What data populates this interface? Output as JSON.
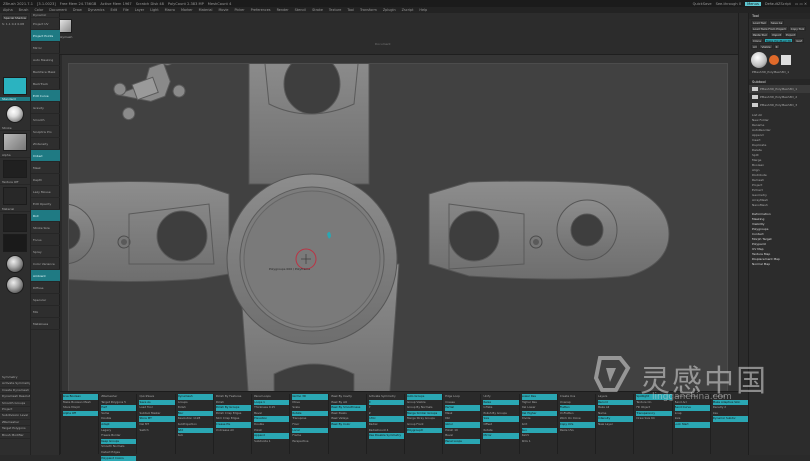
{
  "titlebar": {
    "app": "ZBrush 2021.7.1",
    "version_info": "[3.1.0023]",
    "items": [
      "Free Mem 24.756GB",
      "Active Mem 1967",
      "Scratch Disk 48",
      "PolyCount 2.383 MP",
      "MeshCount 4"
    ],
    "quicksave": "QuickSave",
    "see_through": "See-through 0",
    "menus_btn": "Menus",
    "script_label": "DefaultZScript"
  },
  "menubar": {
    "items": [
      "Alpha",
      "Brush",
      "Color",
      "Document",
      "Draw",
      "Dynamics",
      "Edit",
      "File",
      "Layer",
      "Light",
      "Macro",
      "Marker",
      "Material",
      "Movie",
      "Picker",
      "Preferences",
      "Render",
      "Stencil",
      "Stroke",
      "Texture",
      "Tool",
      "Transform",
      "Zplugin",
      "Zscript",
      "Help"
    ]
  },
  "topshelf": {
    "polymesh_label": "Polymesh",
    "document_label": "Document"
  },
  "leftpanel": {
    "col1": {
      "header": [
        "Special Shadow",
        "Lightbox"
      ],
      "size_label": "S: 1.1 0.2 0.08",
      "rows": [
        "Standard",
        "Dynamic",
        "Stroke",
        "Alpha",
        "Texture Off",
        "Material",
        "Color",
        "Mrgb",
        "Rgb",
        "M",
        "Zadd",
        "Zsub",
        "Zcut",
        "Focal Shift",
        "Draw Size",
        "Z Intensity",
        "Rgb Intensity"
      ],
      "labels_bottom": [
        "Symmetry",
        "Activate Symmetry",
        "Create Dynamesh",
        "Dynamesh Resolution",
        "Smooth Groups",
        "Project",
        "Subdivision Level",
        "ZRemesher",
        "Target Polygons",
        "Brush Modifier"
      ]
    },
    "col2": {
      "header": "Dynamic",
      "rows": [
        "Project UV",
        "Project Points",
        "Mirror",
        "Auto Masking",
        "Backface Mask",
        "BackTrack",
        "Edit Curve",
        "Gravity",
        "Smooth",
        "Sculptris Pro",
        "ZIntensity",
        "Imbed",
        "Mask",
        "Depth",
        "Lazy Mouse",
        "Edit Opacity",
        "Roll",
        "Stroke Size",
        "Focus",
        "Spray",
        "Color Variance",
        "Ambient",
        "Diffuse",
        "Specular",
        "Mix",
        "Metalness"
      ]
    }
  },
  "canvas": {
    "center_label": "Polygroups 000 / Polyframe",
    "doc_top_label": "Document"
  },
  "rightpanel": {
    "title": "Tool",
    "buttons": [
      "Load Tool",
      "Save As",
      "Load Tools From Project",
      "Copy Tool",
      "Paste Tool",
      "Import",
      "Export",
      "Clone",
      "Make PolyMesh3D",
      "GoZ",
      "All",
      "Visible",
      "R"
    ],
    "tool_name": "PMesh3D_PolyMesh3D_1",
    "subtool_title": "Subtool",
    "subtools": [
      "PMesh3D_PolyMesh3D_1",
      "PMesh3D_PolyMesh3D_2",
      "PMesh3D_PolyMesh3D_3"
    ],
    "sections": [
      "List All",
      "New Folder",
      "Rename",
      "AutoReorder",
      "Append",
      "Insert",
      "Duplicate",
      "Delete",
      "Split",
      "Merge",
      "Boolean",
      "Align",
      "Distribute",
      "Remesh",
      "Project",
      "Extract",
      "Geometry",
      "ArrayMesh",
      "NanoMesh"
    ],
    "bottom_items": [
      "Deformation",
      "Masking",
      "Visibility",
      "Polygroups",
      "Contact",
      "Morph Target",
      "Polypaint",
      "UV Map",
      "Texture Map",
      "Displacement Map",
      "Normal Map"
    ]
  },
  "bottom": {
    "groups": [
      {
        "title": "Live Boolean",
        "rows": [
          "Live Boolean",
          "Make Boolean Mesh",
          "Store Morph",
          "Alpha Off"
        ]
      },
      {
        "title": "ZRemesher",
        "rows": [
          "ZRemesher",
          "Target Polygons 5",
          "Half",
          "Same",
          "Double",
          "Adapt",
          "Legacy",
          "Freeze Border",
          "Keep Groups",
          "Smooth Normals",
          "Detect Edges",
          "Polypaint Colors"
        ]
      },
      {
        "title": "QuickSave",
        "rows": [
          "QuickSave",
          "Save As",
          "Load Tool",
          "Subtool Master",
          "Store MT",
          "Del MT",
          "Switch"
        ]
      },
      {
        "title": "Dynamesh",
        "rows": [
          "Dynamesh",
          "Groups",
          "Polish",
          "Blur",
          "Resolution 1128",
          "SubProjection",
          "Add",
          "Sub"
        ]
      },
      {
        "title": "Polish",
        "rows": [
          "Polish By Features",
          "Polish",
          "Polish By Groups",
          "Polish Crisp Edges",
          "Slim Crisp Edges",
          "Crease PG",
          "UnCrease All"
        ]
      },
      {
        "title": "Panel Loops",
        "rows": [
          "Panel Loops",
          "Loops 1",
          "Thickness 0.15",
          "Bevel",
          "Elevation",
          "Double",
          "Polish",
          "Append",
          "Subdivide 1"
        ]
      },
      {
        "title": "Gizmo",
        "rows": [
          "Gizmo 3D",
          "Move",
          "Scale",
          "Rotate",
          "Transpose",
          "Floor",
          "Local",
          "Frame",
          "Perspective"
        ]
      },
      {
        "title": "Mask",
        "rows": [
          "Mask By Cavity",
          "Mask By AO",
          "Mask By Smoothness",
          "Mask Peaks",
          "Mask Valleys",
          "Mask By Color"
        ]
      },
      {
        "title": "Symmetry",
        "rows": [
          "Activate Symmetry",
          "X",
          "Y",
          "Z",
          ">M<",
          "Radial",
          "RadialCount 4",
          "Use Posable Symmetry"
        ]
      },
      {
        "title": "Polygroups",
        "rows": [
          "Auto Groups",
          "Group Visible",
          "Group By Normals",
          "Merge Similar Groups",
          "Merge Stray Groups",
          "Group Front",
          "Polygroupit"
        ]
      },
      {
        "title": "Edge Loop",
        "rows": [
          "Edge Loop",
          "Crease",
          "Partial",
          "Mask",
          "Dbl",
          "Gblur",
          "Polish 10",
          "Bevel",
          "Panel Loops"
        ]
      },
      {
        "title": "Deformation",
        "rows": [
          "Unify",
          "Relax",
          "Inflate",
          "Polish By Groups",
          "Size",
          "Offset",
          "Rotate",
          "Mirror"
        ]
      },
      {
        "title": "Geometry",
        "rows": [
          "Lower Res",
          "Higher Res",
          "Del Lower",
          "Del Higher",
          "Divide",
          "Smt",
          "Suv",
          "ReUV",
          "SDiv 1"
        ]
      },
      {
        "title": "UV Master",
        "rows": [
          "Create Uvs",
          "Unwrap",
          "Flatten",
          "UnFlatten",
          "Work On Clone",
          "Copy UVs",
          "Paste UVs"
        ]
      },
      {
        "title": "Layers",
        "rows": [
          "Layers",
          "Record",
          "Bake All",
          "Name",
          "Intensity",
          "New Layer"
        ]
      },
      {
        "title": "Spotlight",
        "rows": [
          "Spotlight",
          "Texture On",
          "Fill Object",
          "Transparency",
          "Draw Size 64"
        ]
      },
      {
        "title": "Curve",
        "rows": [
          "Curve Functions",
          "Bend Arc",
          "Bend Curve",
          "Snap",
          "Size",
          "Lock Start"
        ]
      },
      {
        "title": "Topology",
        "rows": [
          "Topology",
          "Make Adaptive Skin",
          "Density 2",
          "Ires",
          "Dynamic Subdiv"
        ]
      }
    ]
  },
  "watermark": {
    "cn": "灵感中国",
    "url": "lingganchina.com"
  }
}
